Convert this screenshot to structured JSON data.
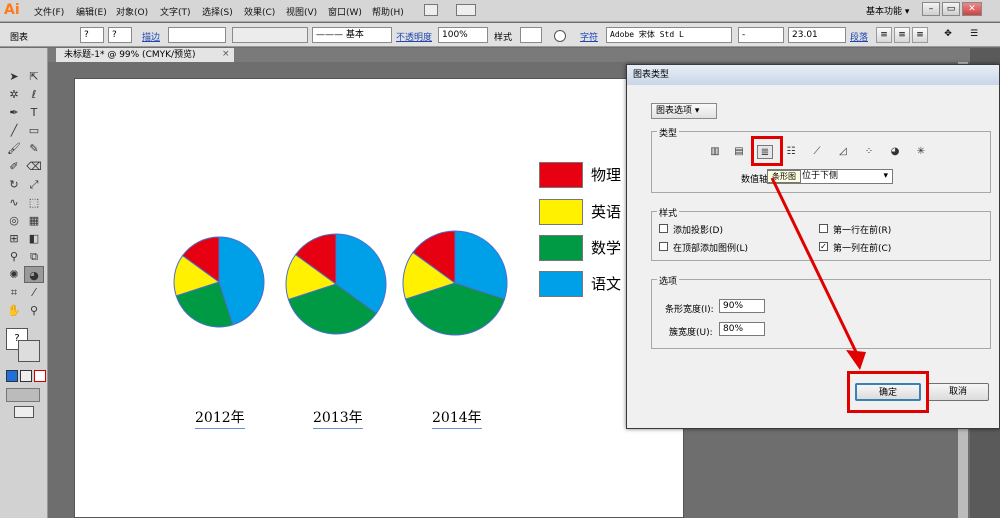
{
  "app": {
    "logo": "Ai",
    "workspace": "基本功能 ▾"
  },
  "menu": [
    "文件(F)",
    "编辑(E)",
    "对象(O)",
    "文字(T)",
    "选择(S)",
    "效果(C)",
    "视图(V)",
    "窗口(W)",
    "帮助(H)"
  ],
  "window_controls": {
    "minimize": "–",
    "restore": "▭",
    "close": "✕"
  },
  "control_bar": {
    "selection_label": "图表",
    "stroke_label": "描边",
    "stroke_style": "基本",
    "opacity_label": "不透明度",
    "opacity_value": "100%",
    "style_label": "样式",
    "char_label": "字符",
    "font_name": "Adobe 宋体 Std L",
    "font_style": "-",
    "font_size": "23.01",
    "para_label": "段落"
  },
  "doc_tab": {
    "title": "未标题-1* @ 99% (CMYK/预览)",
    "close": "×"
  },
  "canvas": {
    "years": [
      "2012年",
      "2013年",
      "2014年"
    ],
    "legend": [
      {
        "label": "物理",
        "color": "#e60012"
      },
      {
        "label": "英语",
        "color": "#fff100"
      },
      {
        "label": "数学",
        "color": "#009944"
      },
      {
        "label": "语文",
        "color": "#00a0e9"
      }
    ],
    "pies": [
      {
        "year": "2012年",
        "values": [
          15,
          15,
          25,
          45
        ]
      },
      {
        "year": "2013年",
        "values": [
          15,
          15,
          35,
          35
        ]
      },
      {
        "year": "2014年",
        "values": [
          15,
          15,
          40,
          30
        ]
      }
    ]
  },
  "dialog": {
    "title": "图表类型",
    "options_dropdown": "图表选项",
    "type_group": "类型",
    "value_axis_label": "数值轴",
    "value_axis_value": "位于下侧",
    "tooltip": "条形图",
    "chart_type_icons": [
      "column-icon",
      "stacked-column-icon",
      "bar-icon",
      "stacked-bar-icon",
      "line-icon",
      "area-icon",
      "scatter-icon",
      "pie-icon",
      "radar-icon"
    ],
    "style_group": "样式",
    "add_shadow": "添加投影(D)",
    "first_row_front": "第一行在前(R)",
    "legend_top": "在顶部添加图例(L)",
    "first_col_front": "第一列在前(C)",
    "options_group": "选项",
    "bar_width_label": "条形宽度(I):",
    "bar_width_value": "90%",
    "cluster_width_label": "簇宽度(U):",
    "cluster_width_value": "80%",
    "ok": "确定",
    "cancel": "取消",
    "checks": {
      "add_shadow": false,
      "first_row_front": false,
      "legend_top": false,
      "first_col_front": true
    }
  }
}
